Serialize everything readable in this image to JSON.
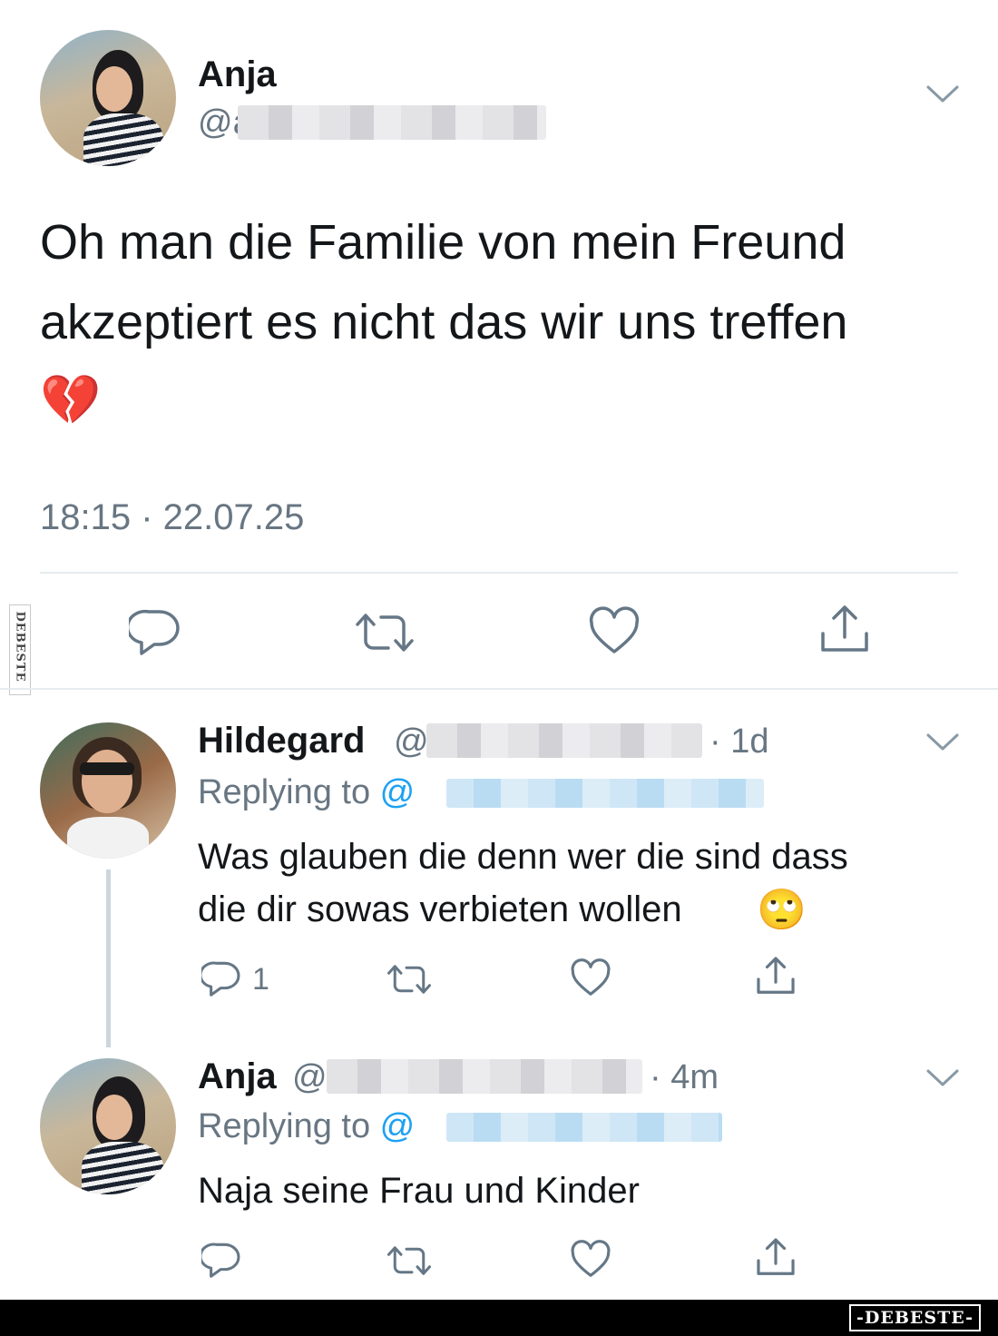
{
  "main_tweet": {
    "author_name": "Anja",
    "handle_prefix": "@a",
    "text_line1": "Oh man die Familie von mein Freund",
    "text_line2": "akzeptiert es nicht das wir uns treffen",
    "emoji": "💔",
    "timestamp": "18:15 · 22.07.25"
  },
  "side_watermark": "DEBESTE",
  "reply1": {
    "author_name": "Hildegard",
    "handle_prefix": "@",
    "age": "· 1d",
    "replying_prefix": "Replying to ",
    "replying_handle_prefix": "@",
    "text_line1": "Was glauben die denn wer die sind dass",
    "text_line2": "die dir sowas verbieten wollen",
    "emoji": "🙄",
    "reply_count": "1"
  },
  "reply2": {
    "author_name": "Anja",
    "handle_prefix": "@",
    "age": "· 4m",
    "replying_prefix": "Replying to ",
    "replying_handle_prefix": "@",
    "text": "Naja seine Frau und Kinder"
  },
  "footer_logo": "-DEBESTE-",
  "colors": {
    "icon": "#657786",
    "text": "#14171a",
    "muted": "#687682",
    "link": "#1da1f2",
    "footer": "#000000"
  },
  "icons": [
    "chevron-down-icon",
    "reply-icon",
    "retweet-icon",
    "like-icon",
    "share-icon"
  ]
}
